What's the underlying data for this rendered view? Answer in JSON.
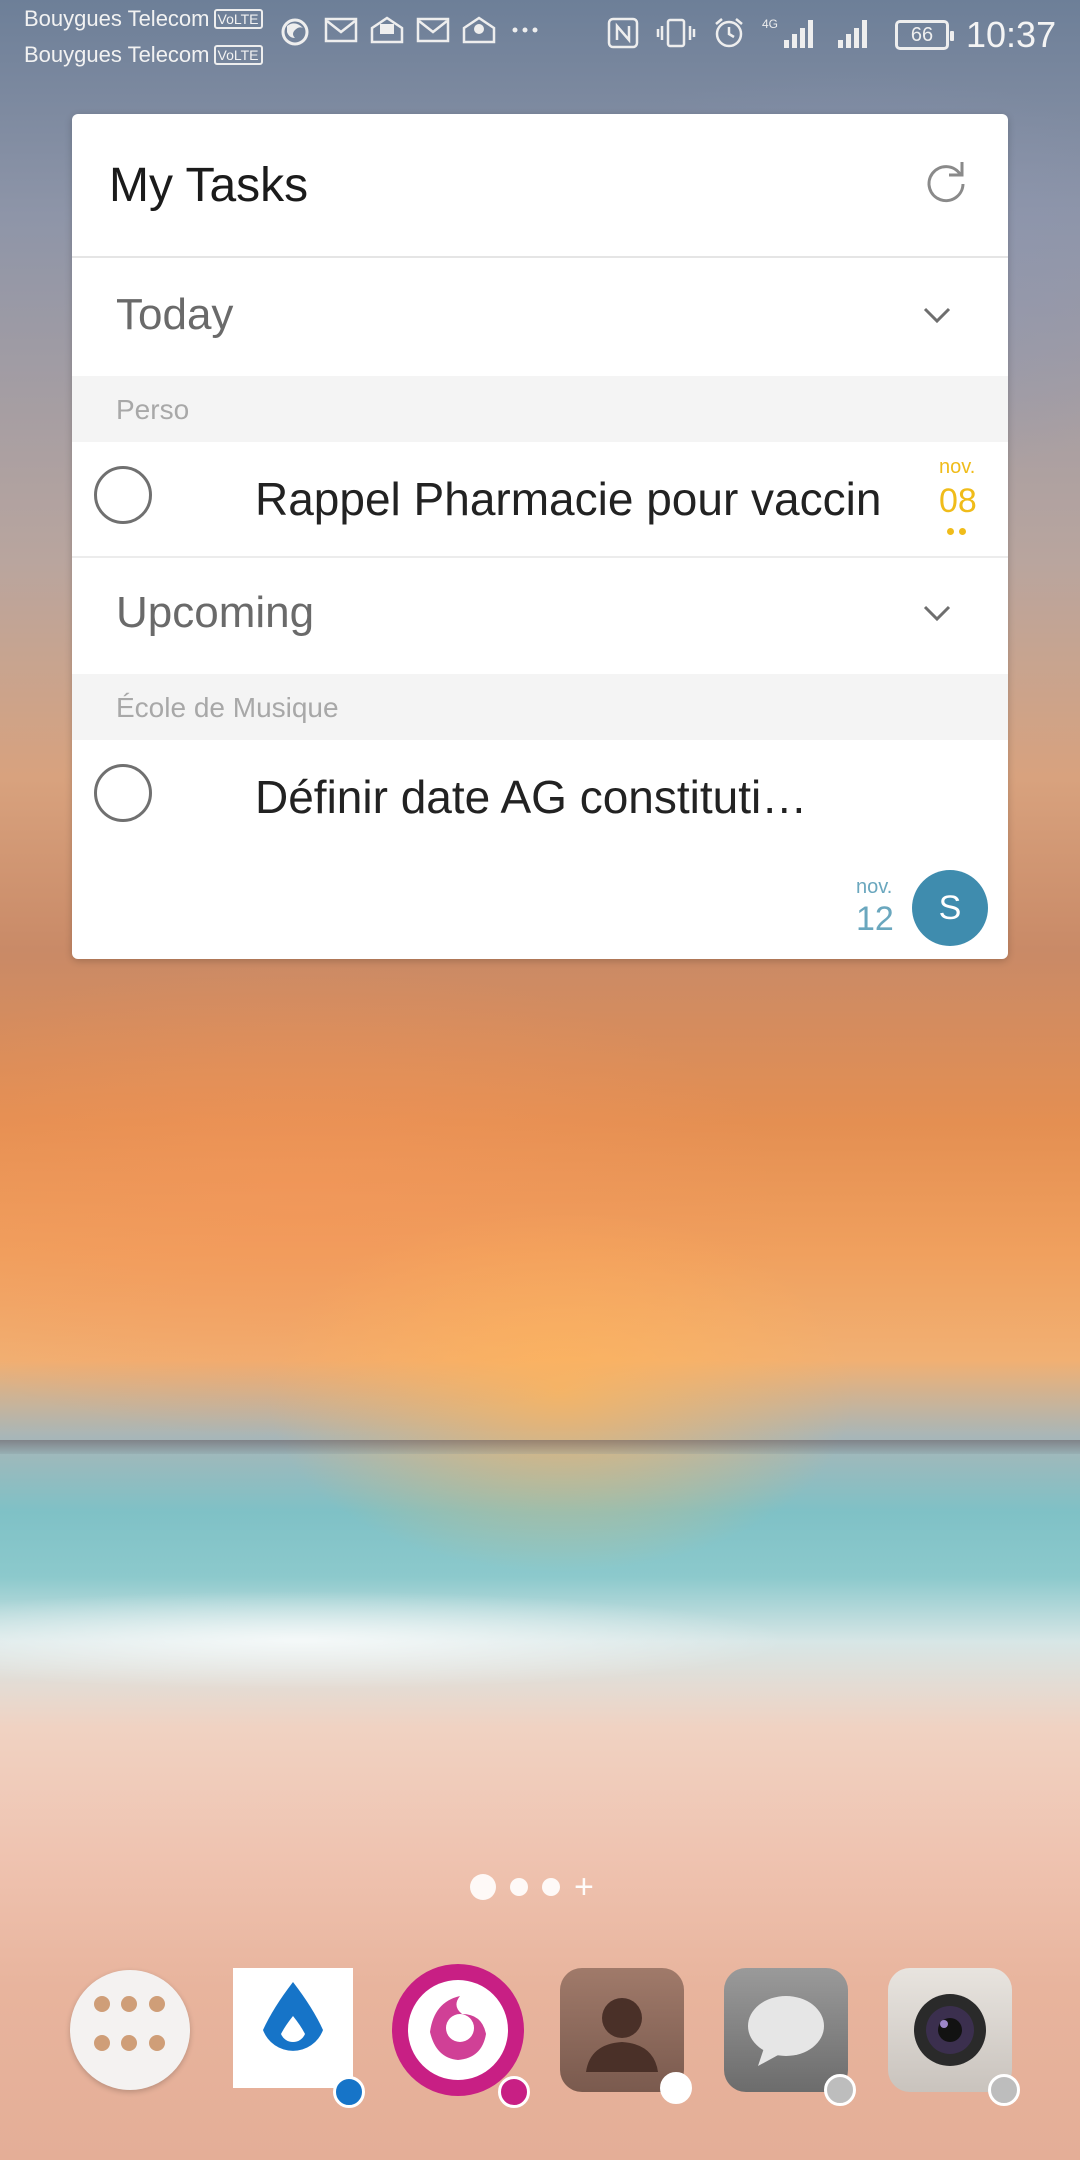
{
  "status_bar": {
    "carrier_1": "Bouygues Telecom",
    "carrier_2": "Bouygues Telecom",
    "volte": "VoLTE",
    "network": "4G",
    "battery": "66",
    "time": "10:37",
    "notification_icons": [
      "firefox-icon",
      "mail-icon",
      "mail-icon",
      "mail-icon",
      "mail-icon",
      "more-icon"
    ],
    "system_icons": [
      "nfc-icon",
      "vibrate-icon",
      "alarm-icon",
      "signal-icon",
      "signal-icon"
    ]
  },
  "widget": {
    "title": "My Tasks",
    "sections": [
      {
        "title": "Today",
        "group": "Perso",
        "task": {
          "title": "Rappel Pharmacie pour vaccin",
          "month": "nov.",
          "day": "08",
          "date_color": "#F0BC1A"
        }
      },
      {
        "title": "Upcoming",
        "group": "École de Musique",
        "task": {
          "title": "Définir date AG constituti…",
          "month": "nov.",
          "day": "12",
          "date_color": "#6AA7BE",
          "assignee_initial": "S",
          "assignee_color": "#3F8CAE"
        }
      }
    ]
  },
  "home": {
    "pages_count": 3,
    "active_page": 1
  },
  "dock": [
    {
      "name": "app-drawer"
    },
    {
      "name": "water-drop-app",
      "accent": "#1674C8"
    },
    {
      "name": "firefox-focus",
      "accent": "#C81F84"
    },
    {
      "name": "contacts"
    },
    {
      "name": "messages"
    },
    {
      "name": "camera"
    }
  ]
}
